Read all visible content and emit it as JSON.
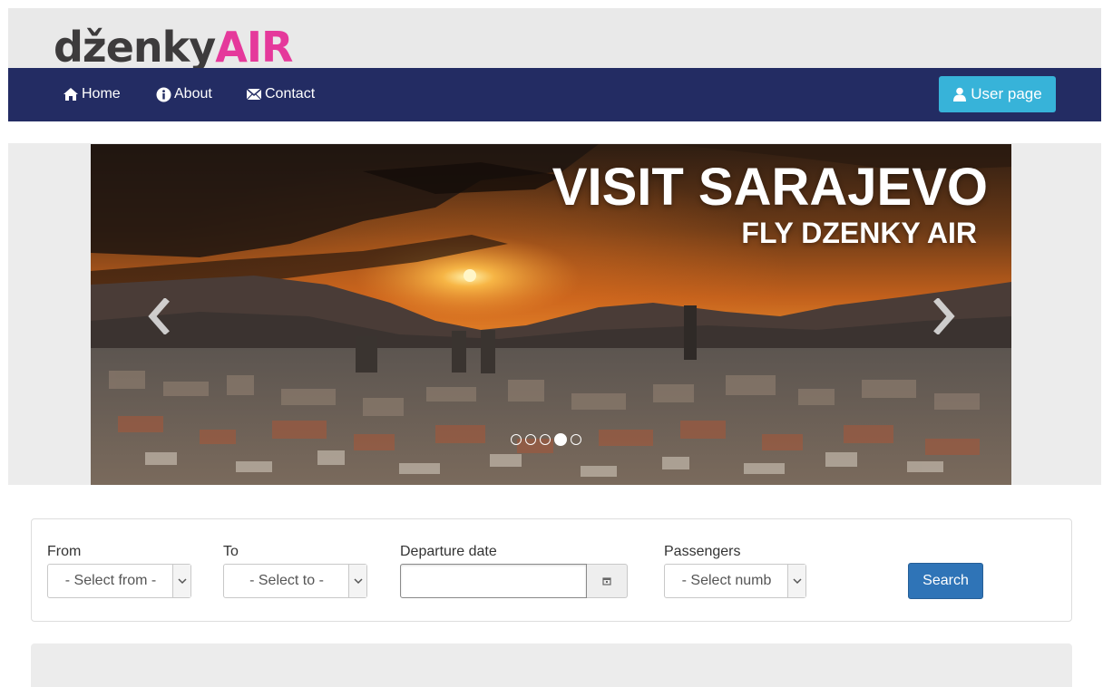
{
  "brand": {
    "logo_dark": "dženky",
    "logo_pink": "AIR"
  },
  "nav": {
    "items": [
      {
        "label": "Home",
        "icon": "home-icon"
      },
      {
        "label": "About",
        "icon": "info-icon"
      },
      {
        "label": "Contact",
        "icon": "envelope-icon"
      }
    ],
    "user_button": {
      "label": "User page",
      "icon": "user-icon"
    }
  },
  "carousel": {
    "headline": "VISIT SARAJEVO",
    "subheadline": "FLY DZENKY AIR",
    "slide_count": 5,
    "active_index": 3
  },
  "search_form": {
    "from": {
      "label": "From",
      "value": "- Select from -"
    },
    "to": {
      "label": "To",
      "value": "- Select to -"
    },
    "departure": {
      "label": "Departure date",
      "value": ""
    },
    "passengers": {
      "label": "Passengers",
      "value": "- Select numb"
    },
    "search_label": "Search"
  },
  "colors": {
    "navbar": "#232c63",
    "user_button": "#37b3d9",
    "search_button": "#2f74b7",
    "logo_pink": "#e5399b",
    "logo_dark": "#3d3b3c"
  }
}
